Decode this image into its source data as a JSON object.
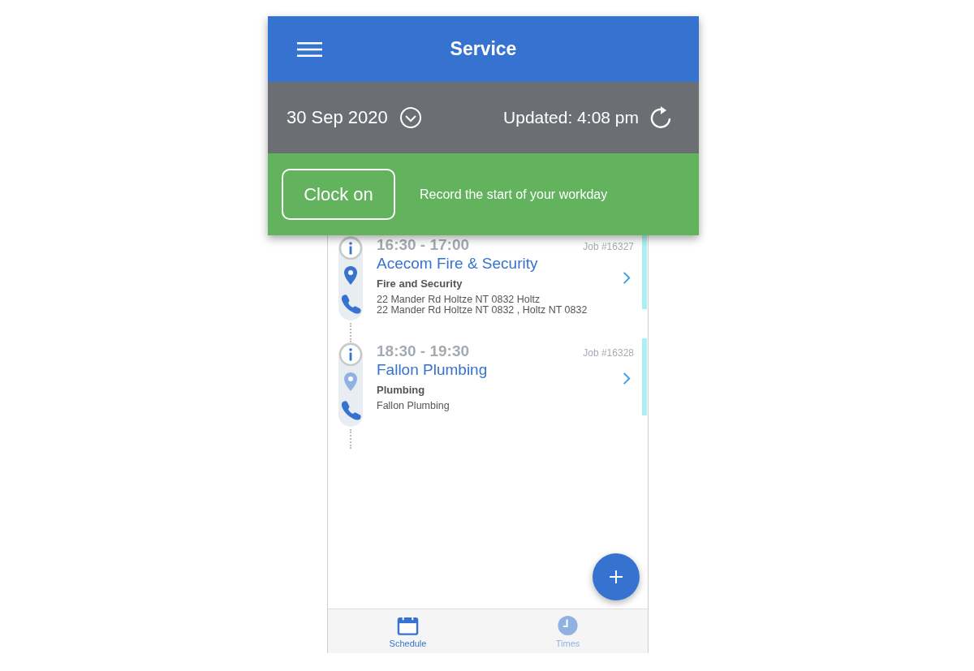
{
  "header": {
    "title": "Service"
  },
  "date_bar": {
    "date": "30 Sep 2020",
    "updated": "Updated: 4:08 pm"
  },
  "clock_bar": {
    "button": "Clock on",
    "hint": "Record the start of your workday"
  },
  "jobs": [
    {
      "time": "16:30 - 17:00",
      "job_no": "Job #16327",
      "customer": "Acecom Fire & Security",
      "type": "Fire and Security",
      "address": [
        "22 Mander Rd Holtze NT 0832 Holtz",
        "22 Mander Rd Holtze NT 0832 , Holtz NT 0832"
      ],
      "location": true
    },
    {
      "time": "18:30 - 19:30",
      "job_no": "Job #16328",
      "customer": "Fallon Plumbing",
      "type": "Plumbing",
      "address": [
        "Fallon Plumbing"
      ],
      "location": false
    }
  ],
  "tabs": [
    {
      "label": "Schedule",
      "kind": "calendar",
      "selected": true
    },
    {
      "label": "Times",
      "kind": "clock",
      "selected": false
    }
  ]
}
